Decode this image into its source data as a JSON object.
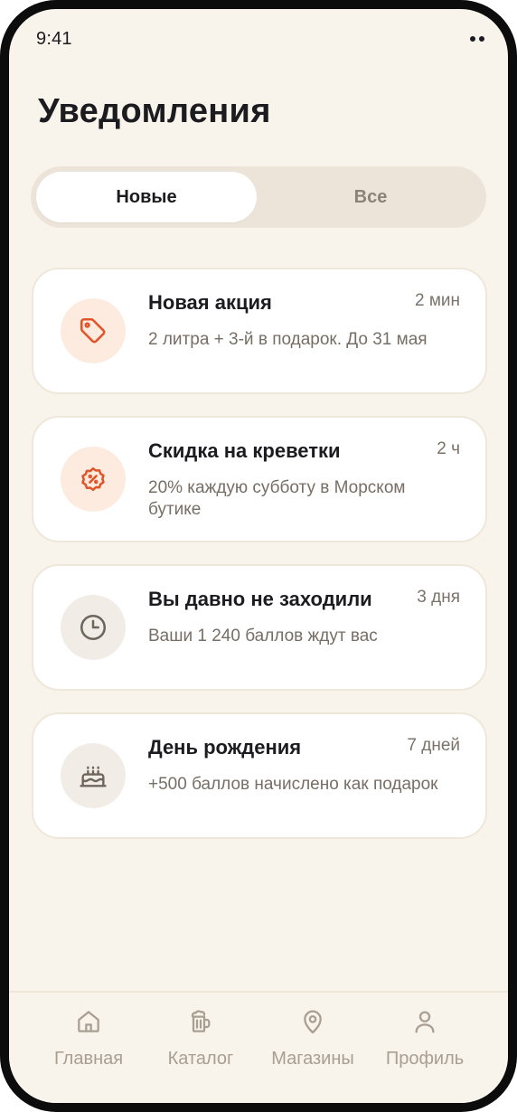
{
  "status_bar": {
    "time": "9:41"
  },
  "page": {
    "title": "Уведомления"
  },
  "segmented": {
    "new_label": "Новые",
    "all_label": "Все",
    "selected": "Новые"
  },
  "notifications": [
    {
      "icon": "tag-icon",
      "title": "Новая акция",
      "time": "2 мин",
      "body": "2 литра + 3-й в подарок. До 31 мая"
    },
    {
      "icon": "discount-badge-icon",
      "title": "Скидка на креветки",
      "time": "2 ч",
      "body": "20% каждую субботу в Морском бутике"
    },
    {
      "icon": "clock-icon",
      "title": "Вы давно не заходили",
      "time": "3 дня",
      "body": "Ваши 1 240 баллов ждут вас"
    },
    {
      "icon": "cake-icon",
      "title": "День рождения",
      "time": "7 дней",
      "body": "+500 баллов начислено как подарок"
    }
  ],
  "tab_bar": [
    {
      "label": "Главная",
      "icon": "home-icon"
    },
    {
      "label": "Каталог",
      "icon": "beer-mug-icon"
    },
    {
      "label": "Магазины",
      "icon": "map-pin-icon"
    },
    {
      "label": "Профиль",
      "icon": "user-icon"
    }
  ],
  "colors": {
    "accent": "#e0552a",
    "background": "#f8f4ec",
    "card": "#ffffff",
    "muted": "#a89e92"
  }
}
